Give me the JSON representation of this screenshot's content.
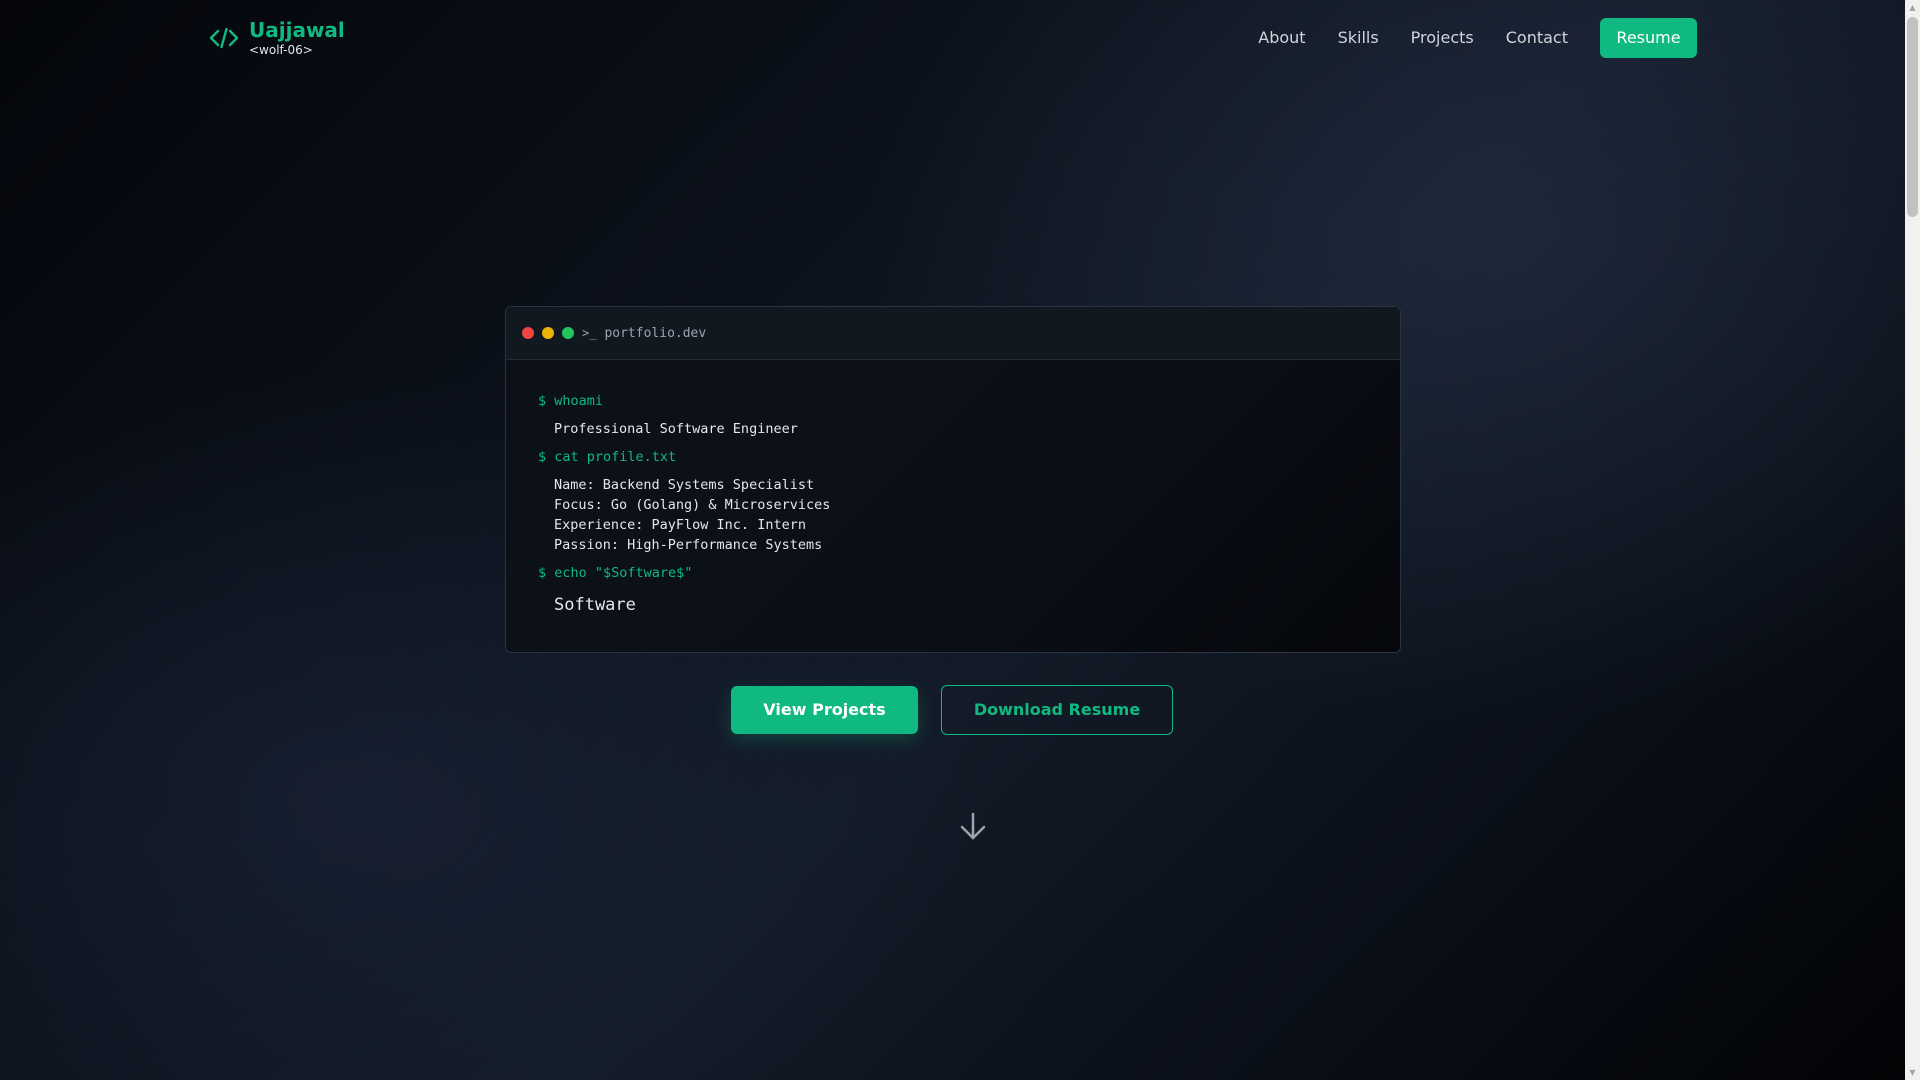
{
  "header": {
    "name": "Uajjawal",
    "handle": "<wolf-06>",
    "nav": [
      "About",
      "Skills",
      "Projects",
      "Contact"
    ],
    "resume_label": "Resume"
  },
  "terminal": {
    "title": "portfolio.dev",
    "dots": [
      "#ef4444",
      "#eab308",
      "#22c55e"
    ],
    "lines": {
      "cmd1": "$ whoami",
      "out1": "Professional Software Engineer",
      "cmd2": "$ cat profile.txt",
      "profile": [
        "Name: Backend Systems Specialist",
        "Focus: Go (Golang) & Microservices",
        "Experience: PayFlow Inc. Intern",
        "Passion: High-Performance Systems"
      ],
      "cmd3": "$ echo \"$Software$\"",
      "out3": "Software"
    }
  },
  "cta": {
    "primary": "View Projects",
    "secondary": "Download Resume"
  },
  "icons": {
    "logo": "code-brackets-icon",
    "prompt": "terminal-prompt-icon",
    "scroll": "arrow-down-icon"
  },
  "colors": {
    "accent": "#10b981"
  }
}
